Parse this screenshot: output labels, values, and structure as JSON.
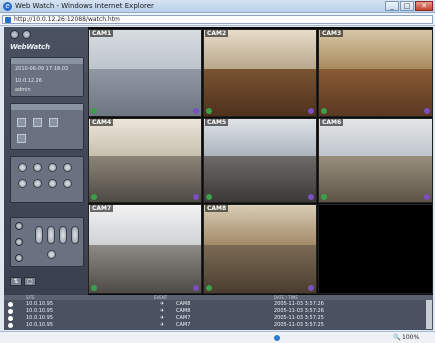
{
  "window": {
    "title": "Web Watch - Windows Internet Explorer",
    "min": "_",
    "max": "□",
    "close": "✕"
  },
  "address": {
    "url": "http://10.0.12.26:12088/watch.htm"
  },
  "app": {
    "brand": "WebWatch",
    "status_box": {
      "datetime": "2010-06-09 17:18:03",
      "ip": "10.0.12.26",
      "user": "admin"
    },
    "cameras": [
      {
        "label": "CAM1"
      },
      {
        "label": "CAM2"
      },
      {
        "label": "CAM3"
      },
      {
        "label": "CAM4"
      },
      {
        "label": "CAM5"
      },
      {
        "label": "CAM6"
      },
      {
        "label": "CAM7"
      },
      {
        "label": "CAM8"
      }
    ]
  },
  "events": {
    "headers": {
      "site": "SITE",
      "event": "EVENT",
      "datetime": "DATE / TIME"
    },
    "rows": [
      {
        "ip": "10.0.10.95",
        "cam": "CAM8",
        "time": "2005-11-03 3:57:26"
      },
      {
        "ip": "10.0.10.95",
        "cam": "CAM8",
        "time": "2005-11-03 3:57:26"
      },
      {
        "ip": "10.0.10.95",
        "cam": "CAM7",
        "time": "2005-11-03 3:57:25"
      },
      {
        "ip": "10.0.10.95",
        "cam": "CAM7",
        "time": "2005-11-03 3:57:25"
      }
    ]
  },
  "statusbar": {
    "zoom": "100%"
  }
}
